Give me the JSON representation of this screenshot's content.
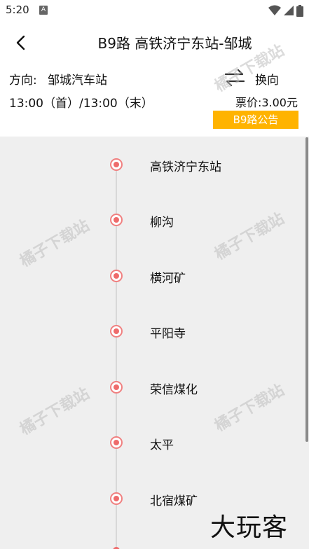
{
  "status": {
    "time": "5:20",
    "notification_icon": "A"
  },
  "header": {
    "title": "B9路 高铁济宁东站-邹城",
    "direction_label": "方向:",
    "direction_value": "邹城汽车站",
    "swap_label": "换向",
    "time_text": "13:00（首）/13:00（末）",
    "fare": "票价:3.00元",
    "notice_button": "B9路公告"
  },
  "stops": [
    {
      "name": "高铁济宁东站"
    },
    {
      "name": "柳沟"
    },
    {
      "name": "横河矿"
    },
    {
      "name": "平阳寺"
    },
    {
      "name": "荣信煤化"
    },
    {
      "name": "太平"
    },
    {
      "name": "北宿煤矿"
    }
  ],
  "watermark": "橘子下载站",
  "logo": "大玩客",
  "colors": {
    "accent": "#ffb300",
    "stop_dot": "#ee6b6b",
    "line": "#d8d8d8"
  },
  "icons": [
    "arrow-left-icon",
    "swap-arrows-icon",
    "wifi-icon",
    "signal-icon",
    "battery-icon"
  ]
}
